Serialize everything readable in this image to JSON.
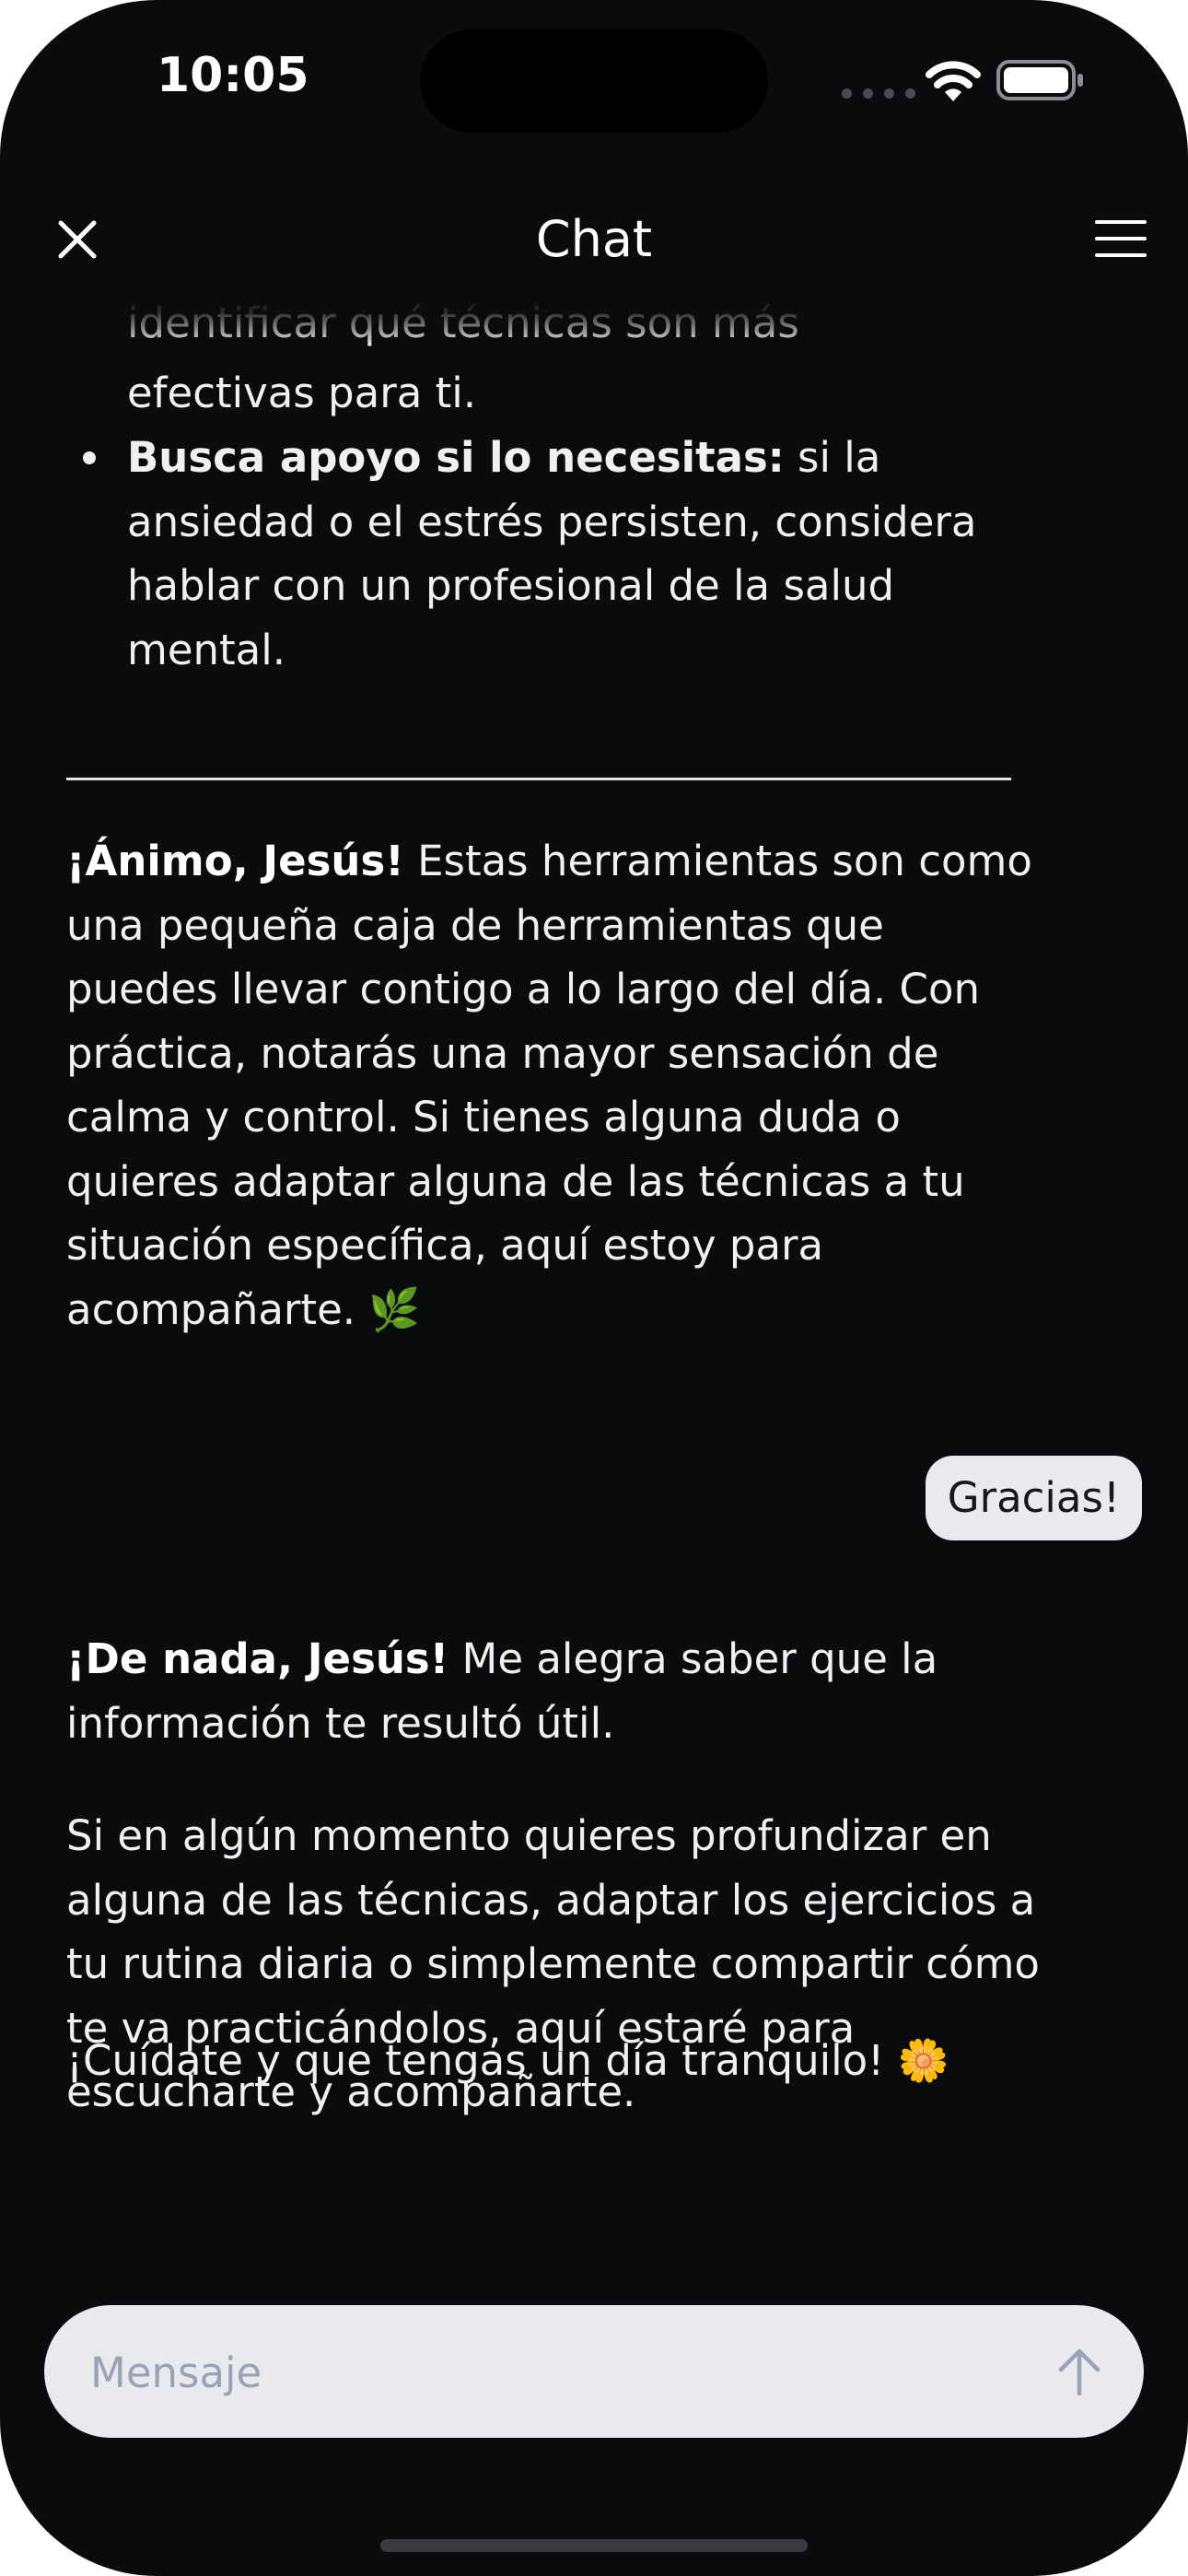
{
  "status_bar": {
    "time": "10:05",
    "icons": [
      "signal-dots-icon",
      "wifi-icon",
      "battery-icon"
    ]
  },
  "nav": {
    "title": "Chat",
    "close_icon": "close-icon",
    "menu_icon": "hamburger-menu-icon"
  },
  "messages": {
    "partial_line": "identificar qué técnicas son más",
    "bullet_prev_tail": "efectivas para ti.",
    "bullet": {
      "bold": "Busca apoyo si lo necesitas:",
      "rest": " si la ansiedad o el estrés persisten, considera hablar con un profesional de la salud mental."
    },
    "closing": {
      "bold": "¡Ánimo, Jesús!",
      "rest": " Estas herramientas son como una pequeña caja de herramientas que puedes llevar contigo a lo largo del día. Con práctica, notarás una mayor sensación de calma y control. Si tienes alguna duda o quieres adaptar alguna de las técnicas a tu situación específica, aquí estoy para acompañarte. 🌿"
    },
    "user_message": "Gracias!",
    "reply_1": {
      "bold": "¡De nada, Jesús!",
      "rest": " Me alegra saber que la información te resultó útil."
    },
    "reply_2": "Si en algún momento quieres profundizar en alguna de las técnicas, adaptar los ejercicios a tu rutina diaria o simplemente compartir cómo te va practicándolos, aquí estaré para escucharte y acompañarte.",
    "reply_3": "¡Cuídate y que tengas un día tranquilo! 🌼"
  },
  "composer": {
    "placeholder": "Mensaje",
    "value": "",
    "send_icon": "arrow-up-icon"
  },
  "colors": {
    "background": "#0a0b0d",
    "text": "#f0f0f2",
    "bubble": "#e9eaee",
    "placeholder": "#9aa3b5"
  }
}
